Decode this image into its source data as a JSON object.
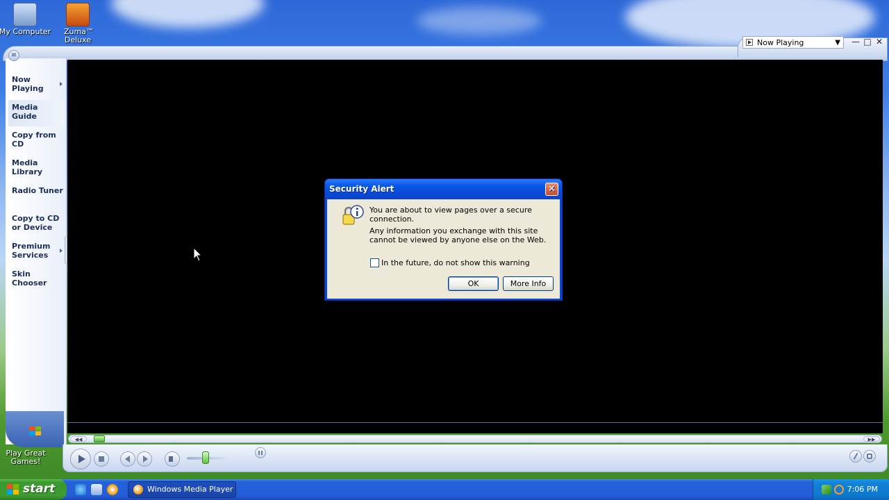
{
  "desktop": {
    "icons": [
      {
        "label": "My Computer"
      },
      {
        "label": "Zuma™ Deluxe"
      },
      {
        "label": "Play Great Games!"
      }
    ]
  },
  "wmp": {
    "view_selector": "Now Playing",
    "nav": [
      {
        "label": "Now Playing",
        "has_arrow": true
      },
      {
        "label": "Media Guide",
        "has_arrow": false
      },
      {
        "label": "Copy from CD",
        "has_arrow": false
      },
      {
        "label": "Media Library",
        "has_arrow": false
      },
      {
        "label": "Radio Tuner",
        "has_arrow": false
      },
      {
        "label": "Copy to CD or Device",
        "has_arrow": false
      },
      {
        "label": "Premium Services",
        "has_arrow": true
      },
      {
        "label": "Skin Chooser",
        "has_arrow": false
      }
    ],
    "active_nav": "Media Guide"
  },
  "dialog": {
    "title": "Security Alert",
    "line1": "You are about to view pages over a secure connection.",
    "line2": "Any information you exchange with this site cannot be viewed by anyone else on the Web.",
    "checkbox_label": "In the future, do not show this warning",
    "checkbox_checked": false,
    "ok_label": "OK",
    "more_info_label": "More Info"
  },
  "taskbar": {
    "start_label": "start",
    "task_label": "Windows Media Player",
    "clock": "7:06 PM"
  },
  "colors": {
    "dialog_title": "#0a46d8",
    "start_green": "#3c9b31",
    "taskbar_blue": "#245dd7"
  }
}
